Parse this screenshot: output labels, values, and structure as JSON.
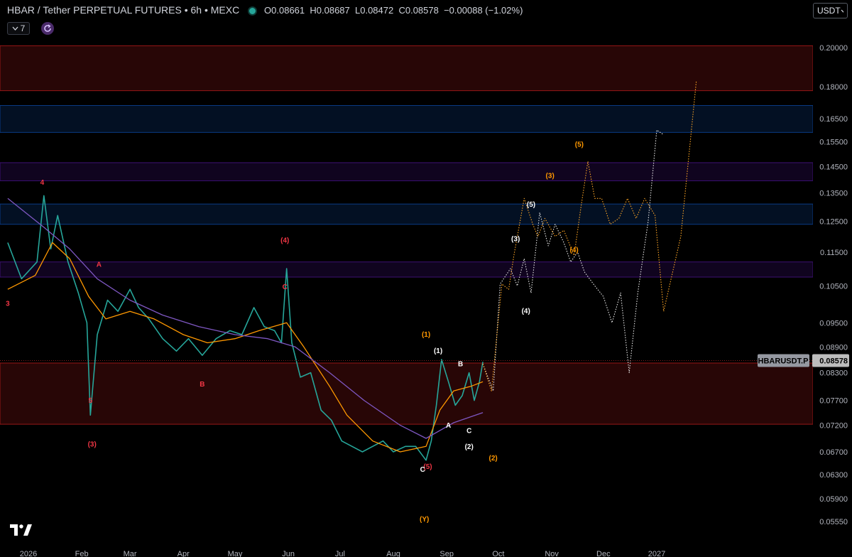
{
  "header": {
    "symbol": "HBAR / Tether PERPETUAL FUTURES • 6h • MEXC",
    "open_label": "O",
    "open": "0.08661",
    "high_label": "H",
    "high": "0.08687",
    "low_label": "L",
    "low": "0.08472",
    "close_label": "C",
    "close": "0.08578",
    "change": "−0.00088 (−1.02%)"
  },
  "toolbar": {
    "interval_count": "7",
    "currency": "USDT"
  },
  "colors": {
    "background": "#000000",
    "price_line": "#26a69a",
    "ma_orange": "#ff9800",
    "ma_purple": "#7e57c2",
    "zone_red": "#b71c1c",
    "zone_blue": "#0d47a1",
    "zone_purple": "#4a148c",
    "label_red": "#f23645",
    "label_orange": "#ff9800",
    "label_white": "#ffffff"
  },
  "chart_data": {
    "type": "line",
    "title": "HBAR / Tether PERPETUAL FUTURES • 6h • MEXC",
    "y_scale": "log",
    "ylim": [
      0.053,
      0.21
    ],
    "y_ticks": [
      "0.20000",
      "0.18000",
      "0.16500",
      "0.15500",
      "0.14500",
      "0.13500",
      "0.12500",
      "0.11500",
      "0.10500",
      "0.09500",
      "0.08900",
      "0.08300",
      "0.07700",
      "0.07200",
      "0.06700",
      "0.06300",
      "0.05900",
      "0.05550"
    ],
    "y_tick_values": [
      0.2,
      0.18,
      0.165,
      0.155,
      0.145,
      0.135,
      0.125,
      0.115,
      0.105,
      0.095,
      0.089,
      0.083,
      0.077,
      0.072,
      0.067,
      0.063,
      0.059,
      0.0555
    ],
    "x_ticks": [
      "2026",
      "Feb",
      "Mar",
      "Apr",
      "May",
      "Jun",
      "Jul",
      "Aug",
      "Sep",
      "Oct",
      "Nov",
      "Dec",
      "2027"
    ],
    "x_tick_dates": [
      "2026-01-01",
      "2026-02-01",
      "2026-03-01",
      "2026-04-01",
      "2026-05-01",
      "2026-06-01",
      "2026-07-01",
      "2026-08-01",
      "2026-09-01",
      "2026-10-01",
      "2026-11-01",
      "2026-12-01",
      "2027-01-01"
    ],
    "price_tag": {
      "symbol": "HBARUSDT.P",
      "value": "0.08578"
    },
    "zones": [
      {
        "color": "red",
        "from": 0.178,
        "to": 0.201
      },
      {
        "color": "blue",
        "from": 0.159,
        "to": 0.171
      },
      {
        "color": "purple",
        "from": 0.1395,
        "to": 0.1465
      },
      {
        "color": "blue",
        "from": 0.124,
        "to": 0.131
      },
      {
        "color": "purple",
        "from": 0.1075,
        "to": 0.112
      },
      {
        "color": "red",
        "from": 0.0722,
        "to": 0.0852
      }
    ],
    "series": [
      {
        "type": "price",
        "x": [
          "2025-12-20",
          "2025-12-28",
          "2026-01-06",
          "2026-01-10",
          "2026-01-14",
          "2026-01-18",
          "2026-01-24",
          "2026-01-30",
          "2026-02-04",
          "2026-02-06",
          "2026-02-10",
          "2026-02-16",
          "2026-02-22",
          "2026-03-01",
          "2026-03-06",
          "2026-03-12",
          "2026-03-20",
          "2026-03-28",
          "2026-04-04",
          "2026-04-12",
          "2026-04-20",
          "2026-04-28",
          "2026-05-05",
          "2026-05-12",
          "2026-05-18",
          "2026-05-24",
          "2026-05-28",
          "2026-05-31",
          "2026-06-03",
          "2026-06-08",
          "2026-06-14",
          "2026-06-20",
          "2026-06-26",
          "2026-07-02",
          "2026-07-08",
          "2026-07-14",
          "2026-07-20",
          "2026-07-26",
          "2026-08-01",
          "2026-08-08",
          "2026-08-14",
          "2026-08-20",
          "2026-08-23",
          "2026-08-26",
          "2026-08-29",
          "2026-09-02",
          "2026-09-06",
          "2026-09-10",
          "2026-09-14",
          "2026-09-17",
          "2026-09-20",
          "2026-09-22"
        ],
        "y": [
          0.118,
          0.107,
          0.112,
          0.134,
          0.116,
          0.127,
          0.112,
          0.103,
          0.095,
          0.074,
          0.092,
          0.101,
          0.098,
          0.104,
          0.099,
          0.096,
          0.091,
          0.088,
          0.091,
          0.087,
          0.091,
          0.093,
          0.092,
          0.099,
          0.094,
          0.093,
          0.09,
          0.11,
          0.09,
          0.082,
          0.083,
          0.075,
          0.073,
          0.069,
          0.068,
          0.067,
          0.068,
          0.069,
          0.067,
          0.068,
          0.068,
          0.0655,
          0.069,
          0.076,
          0.086,
          0.081,
          0.076,
          0.078,
          0.083,
          0.077,
          0.081,
          0.0855
        ]
      },
      {
        "type": "ma_orange",
        "x": [
          "2025-12-20",
          "2026-01-05",
          "2026-01-15",
          "2026-01-25",
          "2026-02-05",
          "2026-02-15",
          "2026-03-01",
          "2026-03-15",
          "2026-04-01",
          "2026-04-15",
          "2026-05-01",
          "2026-05-15",
          "2026-05-31",
          "2026-06-10",
          "2026-06-25",
          "2026-07-05",
          "2026-07-20",
          "2026-08-05",
          "2026-08-20",
          "2026-08-28",
          "2026-09-05",
          "2026-09-15",
          "2026-09-22"
        ],
        "y": [
          0.104,
          0.108,
          0.118,
          0.113,
          0.102,
          0.096,
          0.098,
          0.096,
          0.092,
          0.09,
          0.091,
          0.093,
          0.095,
          0.089,
          0.08,
          0.074,
          0.069,
          0.067,
          0.068,
          0.075,
          0.079,
          0.08,
          0.081
        ]
      },
      {
        "type": "ma_purple",
        "x": [
          "2025-12-20",
          "2026-01-10",
          "2026-01-25",
          "2026-02-10",
          "2026-03-01",
          "2026-03-20",
          "2026-04-10",
          "2026-05-01",
          "2026-05-20",
          "2026-06-05",
          "2026-06-25",
          "2026-07-15",
          "2026-08-05",
          "2026-08-20",
          "2026-09-05",
          "2026-09-22"
        ],
        "y": [
          0.133,
          0.123,
          0.116,
          0.107,
          0.101,
          0.097,
          0.094,
          0.092,
          0.091,
          0.089,
          0.083,
          0.077,
          0.072,
          0.0695,
          0.0725,
          0.0745
        ]
      },
      {
        "type": "projection_white",
        "x": [
          "2026-09-22",
          "2026-09-28",
          "2026-10-02",
          "2026-10-08",
          "2026-10-12",
          "2026-10-16",
          "2026-10-20",
          "2026-10-25",
          "2026-10-30",
          "2026-11-03",
          "2026-11-08",
          "2026-11-12",
          "2026-11-16",
          "2026-11-20",
          "2026-11-26",
          "2026-12-01",
          "2026-12-06",
          "2026-12-11",
          "2026-12-16",
          "2026-12-21",
          "2026-12-27",
          "2027-01-01",
          "2027-01-05"
        ],
        "y": [
          0.085,
          0.079,
          0.1055,
          0.11,
          0.105,
          0.113,
          0.103,
          0.128,
          0.117,
          0.124,
          0.118,
          0.112,
          0.115,
          0.109,
          0.105,
          0.102,
          0.095,
          0.103,
          0.083,
          0.103,
          0.125,
          0.16,
          0.158
        ]
      },
      {
        "type": "projection_orange",
        "x": [
          "2026-09-22",
          "2026-09-27",
          "2026-10-03",
          "2026-10-07",
          "2026-10-10",
          "2026-10-16",
          "2026-10-21",
          "2026-10-24",
          "2026-10-28",
          "2026-11-03",
          "2026-11-08",
          "2026-11-14",
          "2026-11-18",
          "2026-11-22",
          "2026-11-26",
          "2026-11-30",
          "2026-12-05",
          "2026-12-10",
          "2026-12-15",
          "2026-12-20",
          "2026-12-25",
          "2026-12-31",
          "2027-01-05",
          "2027-01-15",
          "2027-01-24"
        ],
        "y": [
          0.085,
          0.079,
          0.1055,
          0.104,
          0.114,
          0.133,
          0.124,
          0.12,
          0.126,
          0.12,
          0.122,
          0.114,
          0.13,
          0.147,
          0.133,
          0.133,
          0.124,
          0.126,
          0.133,
          0.126,
          0.133,
          0.127,
          0.098,
          0.12,
          0.183
        ]
      }
    ],
    "wave_labels": [
      {
        "text": "3",
        "color": "red",
        "x": "2025-12-20",
        "y": 0.0995
      },
      {
        "text": "4",
        "color": "red",
        "x": "2026-01-09",
        "y": 0.138
      },
      {
        "text": "5",
        "color": "red",
        "x": "2026-02-06",
        "y": 0.0765
      },
      {
        "text": "(3)",
        "color": "red",
        "x": "2026-02-07",
        "y": 0.068
      },
      {
        "text": "A",
        "color": "red",
        "x": "2026-02-11",
        "y": 0.1105
      },
      {
        "text": "B",
        "color": "red",
        "x": "2026-04-12",
        "y": 0.08
      },
      {
        "text": "(4)",
        "color": "red",
        "x": "2026-05-30",
        "y": 0.118
      },
      {
        "text": "C",
        "color": "red",
        "x": "2026-05-30",
        "y": 0.104
      },
      {
        "text": "(5)",
        "color": "red",
        "x": "2026-08-21",
        "y": 0.064
      },
      {
        "text": "C",
        "color": "white",
        "x": "2026-08-18",
        "y": 0.0635
      },
      {
        "text": "(1)",
        "color": "orange",
        "x": "2026-08-20",
        "y": 0.0915
      },
      {
        "text": "(1)",
        "color": "white",
        "x": "2026-08-27",
        "y": 0.0875
      },
      {
        "text": "B",
        "color": "white",
        "x": "2026-09-09",
        "y": 0.0845
      },
      {
        "text": "A",
        "color": "white",
        "x": "2026-09-02",
        "y": 0.0715
      },
      {
        "text": "C",
        "color": "white",
        "x": "2026-09-14",
        "y": 0.0705
      },
      {
        "text": "(2)",
        "color": "white",
        "x": "2026-09-14",
        "y": 0.0675
      },
      {
        "text": "(2)",
        "color": "orange",
        "x": "2026-09-28",
        "y": 0.0655
      },
      {
        "text": "(Y)",
        "color": "orange",
        "x": "2026-08-19",
        "y": 0.0555
      },
      {
        "text": "(3)",
        "color": "white",
        "x": "2026-10-11",
        "y": 0.1185
      },
      {
        "text": "(4)",
        "color": "white",
        "x": "2026-10-17",
        "y": 0.0975
      },
      {
        "text": "(5)",
        "color": "white",
        "x": "2026-10-20",
        "y": 0.13
      },
      {
        "text": "(3)",
        "color": "orange",
        "x": "2026-10-31",
        "y": 0.1405
      },
      {
        "text": "(4)",
        "color": "orange",
        "x": "2026-11-14",
        "y": 0.115
      },
      {
        "text": "(5)",
        "color": "orange",
        "x": "2026-11-17",
        "y": 0.153
      }
    ]
  }
}
